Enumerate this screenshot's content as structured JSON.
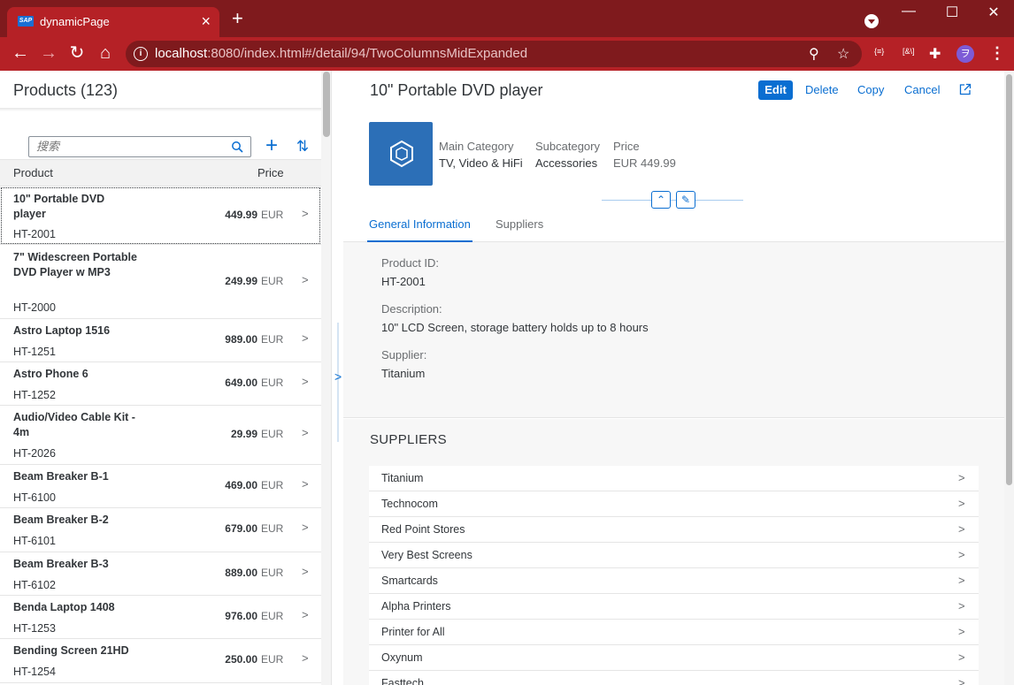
{
  "browser": {
    "tab_title": "dynamicPage",
    "favicon_text": "SAP",
    "url_host": "localhost",
    "url_rest": ":8080/index.html#/detail/94/TwoColumnsMidExpanded",
    "avatar_letter": "ヲ",
    "ext1": "{≡}",
    "ext2": "[&\\]"
  },
  "list": {
    "title": "Products (123)",
    "search_placeholder": "搜索",
    "col_product": "Product",
    "col_price": "Price",
    "items": [
      {
        "name": "10\" Portable DVD player",
        "id": "HT-2001",
        "price": "449.99",
        "currency": "EUR"
      },
      {
        "name": "7\" Widescreen Portable DVD Player w MP3",
        "id": "HT-2000",
        "price": "249.99",
        "currency": "EUR"
      },
      {
        "name": "Astro Laptop 1516",
        "id": "HT-1251",
        "price": "989.00",
        "currency": "EUR"
      },
      {
        "name": "Astro Phone 6",
        "id": "HT-1252",
        "price": "649.00",
        "currency": "EUR"
      },
      {
        "name": "Audio/Video Cable Kit - 4m",
        "id": "HT-2026",
        "price": "29.99",
        "currency": "EUR"
      },
      {
        "name": "Beam Breaker B-1",
        "id": "HT-6100",
        "price": "469.00",
        "currency": "EUR"
      },
      {
        "name": "Beam Breaker B-2",
        "id": "HT-6101",
        "price": "679.00",
        "currency": "EUR"
      },
      {
        "name": "Beam Breaker B-3",
        "id": "HT-6102",
        "price": "889.00",
        "currency": "EUR"
      },
      {
        "name": "Benda Laptop 1408",
        "id": "HT-1253",
        "price": "976.00",
        "currency": "EUR"
      },
      {
        "name": "Bending Screen 21HD",
        "id": "HT-1254",
        "price": "250.00",
        "currency": "EUR"
      }
    ]
  },
  "detail": {
    "title": "10\" Portable DVD player",
    "actions": {
      "edit": "Edit",
      "delete": "Delete",
      "copy": "Copy",
      "cancel": "Cancel"
    },
    "main_category_label": "Main Category",
    "main_category_value": "TV, Video & HiFi",
    "subcategory_label": "Subcategory",
    "subcategory_value": "Accessories",
    "price_label": "Price",
    "price_value": "EUR 449.99",
    "tabs": [
      "General Information",
      "Suppliers"
    ],
    "fields": {
      "product_id_label": "Product ID:",
      "product_id_value": "HT-2001",
      "description_label": "Description:",
      "description_value": "10\" LCD Screen, storage battery holds up to 8 hours",
      "supplier_label": "Supplier:",
      "supplier_value": "Titanium"
    },
    "suppliers_title": "SUPPLIERS",
    "suppliers": [
      "Titanium",
      "Technocom",
      "Red Point Stores",
      "Very Best Screens",
      "Smartcards",
      "Alpha Printers",
      "Printer for All",
      "Oxynum",
      "Fasttech"
    ]
  },
  "colors": {
    "accent": "#0a6ed1",
    "browser_dark": "#7f1a1d",
    "browser_tab": "#b52126"
  }
}
